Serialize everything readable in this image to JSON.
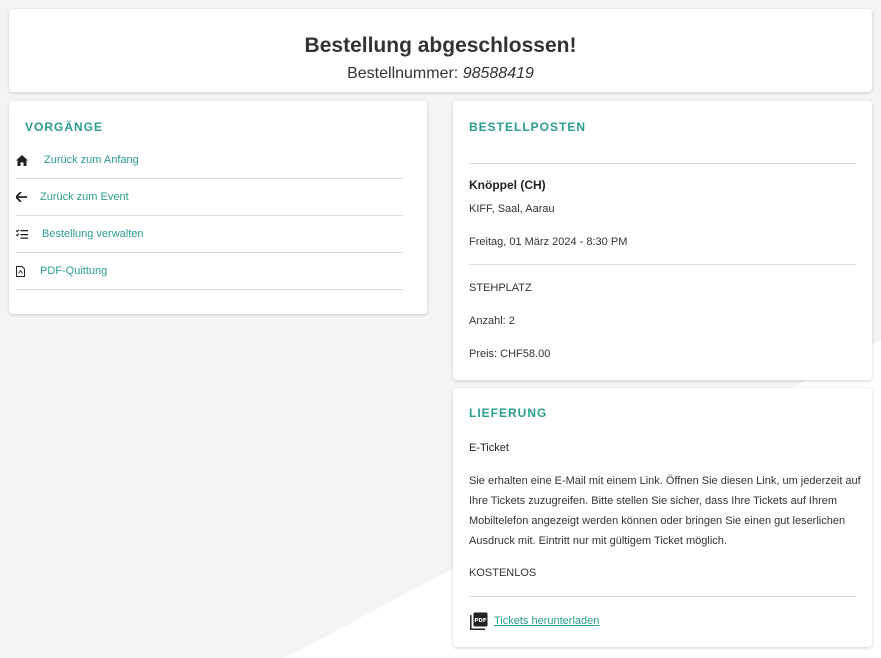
{
  "header": {
    "title": "Bestellung abgeschlossen!",
    "order_label": "Bestellnummer:",
    "order_number": "98588419"
  },
  "actions": {
    "title": "VORGÄNGE",
    "items": [
      {
        "label": "Zurück zum Anfang",
        "icon": "home-icon"
      },
      {
        "label": "Zurück zum Event",
        "icon": "arrow-left-icon"
      },
      {
        "label": "Bestellung verwalten",
        "icon": "checklist-icon"
      },
      {
        "label": "PDF-Quittung",
        "icon": "pdf-file-icon"
      }
    ]
  },
  "order_items": {
    "title": "BESTELLPOSTEN",
    "event_name": "Knöppel (CH)",
    "venue": "KIFF, Saal, Aarau",
    "date": "Freitag, 01 März 2024 - 8:30 PM",
    "ticket_type": "STEHPLATZ",
    "quantity": "Anzahl: 2",
    "price": "Preis: CHF58.00"
  },
  "delivery": {
    "title": "LIEFERUNG",
    "method": "E-Ticket",
    "description": "Sie erhalten eine E-Mail mit einem Link. Öffnen Sie diesen Link, um jederzeit auf Ihre Tickets zuzugreifen. Bitte stellen Sie sicher, dass Ihre Tickets auf Ihrem Mobiltelefon angezeigt werden können oder bringen Sie einen gut leserlichen Ausdruck mit. Eintritt nur mit gültigem Ticket möglich.",
    "cost": "KOSTENLOS",
    "download_label": "Tickets herunterladen",
    "download_icon_text": "PDF"
  },
  "colors": {
    "accent": "#2a9d8f",
    "background": "#f4f4f4",
    "card": "#ffffff"
  }
}
